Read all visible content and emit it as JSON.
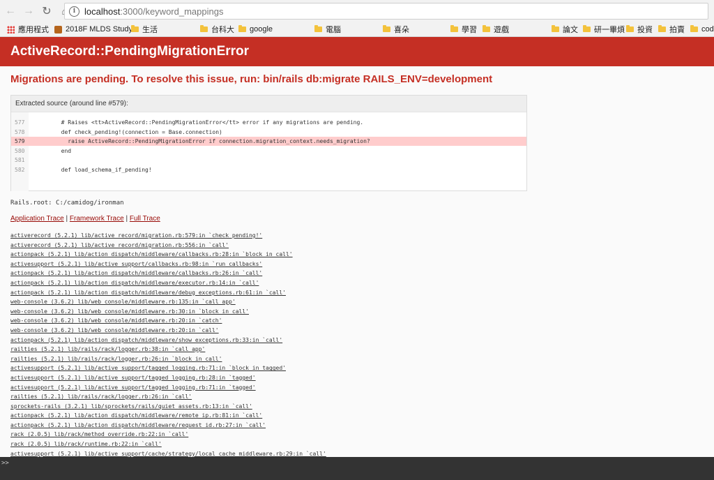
{
  "browser": {
    "url_host": "localhost",
    "url_path": ":3000/keyword_mappings",
    "bookmarks": [
      {
        "label": "應用程式",
        "icon": "apps-grid-icon"
      },
      {
        "label": "2018F MLDS Study",
        "icon": "site-favicon-icon"
      },
      {
        "label": "生活",
        "icon": "folder-icon"
      },
      {
        "label": "台科大",
        "icon": "folder-icon"
      },
      {
        "label": "google",
        "icon": "folder-icon"
      },
      {
        "label": "電腦",
        "icon": "folder-icon"
      },
      {
        "label": "喜朵",
        "icon": "folder-icon"
      },
      {
        "label": "學習",
        "icon": "folder-icon"
      },
      {
        "label": "遊戲",
        "icon": "folder-icon"
      },
      {
        "label": "論文",
        "icon": "folder-icon"
      },
      {
        "label": "研一畢煩",
        "icon": "folder-icon"
      },
      {
        "label": "投資",
        "icon": "folder-icon"
      },
      {
        "label": "拍賣",
        "icon": "folder-icon"
      },
      {
        "label": "code",
        "icon": "folder-icon"
      }
    ]
  },
  "error": {
    "header": "ActiveRecord::PendingMigrationError",
    "message": "Migrations are pending. To resolve this issue, run: bin/rails db:migrate RAILS_ENV=development",
    "source_title": "Extracted source (around line #579):",
    "lines": [
      {
        "num": "577",
        "code": "  # Raises <tt>ActiveRecord::PendingMigrationError</tt> error if any migrations are pending."
      },
      {
        "num": "578",
        "code": "  def check_pending!(connection = Base.connection)"
      },
      {
        "num": "579",
        "code": "    raise ActiveRecord::PendingMigrationError if connection.migration_context.needs_migration?"
      },
      {
        "num": "580",
        "code": "  end"
      },
      {
        "num": "581",
        "code": ""
      },
      {
        "num": "582",
        "code": "  def load_schema_if_pending!"
      }
    ],
    "highlight_line": "579",
    "rails_root": "Rails.root: C:/camidog/ironman"
  },
  "trace_tabs": [
    "Application Trace",
    "Framework Trace",
    "Full Trace"
  ],
  "trace": [
    "activerecord (5.2.1) lib/active_record/migration.rb:579:in `check_pending!'",
    "activerecord (5.2.1) lib/active_record/migration.rb:556:in `call'",
    "actionpack (5.2.1) lib/action_dispatch/middleware/callbacks.rb:28:in `block in call'",
    "activesupport (5.2.1) lib/active_support/callbacks.rb:98:in `run_callbacks'",
    "actionpack (5.2.1) lib/action_dispatch/middleware/callbacks.rb:26:in `call'",
    "actionpack (5.2.1) lib/action_dispatch/middleware/executor.rb:14:in `call'",
    "actionpack (5.2.1) lib/action_dispatch/middleware/debug_exceptions.rb:61:in `call'",
    "web-console (3.6.2) lib/web_console/middleware.rb:135:in `call_app'",
    "web-console (3.6.2) lib/web_console/middleware.rb:30:in `block in call'",
    "web-console (3.6.2) lib/web_console/middleware.rb:20:in `catch'",
    "web-console (3.6.2) lib/web_console/middleware.rb:20:in `call'",
    "actionpack (5.2.1) lib/action_dispatch/middleware/show_exceptions.rb:33:in `call'",
    "railties (5.2.1) lib/rails/rack/logger.rb:38:in `call_app'",
    "railties (5.2.1) lib/rails/rack/logger.rb:26:in `block in call'",
    "activesupport (5.2.1) lib/active_support/tagged_logging.rb:71:in `block in tagged'",
    "activesupport (5.2.1) lib/active_support/tagged_logging.rb:28:in `tagged'",
    "activesupport (5.2.1) lib/active_support/tagged_logging.rb:71:in `tagged'",
    "railties (5.2.1) lib/rails/rack/logger.rb:26:in `call'",
    "sprockets-rails (3.2.1) lib/sprockets/rails/quiet_assets.rb:13:in `call'",
    "actionpack (5.2.1) lib/action_dispatch/middleware/remote_ip.rb:81:in `call'",
    "actionpack (5.2.1) lib/action_dispatch/middleware/request_id.rb:27:in `call'",
    "rack (2.0.5) lib/rack/method_override.rb:22:in `call'",
    "rack (2.0.5) lib/rack/runtime.rb:22:in `call'",
    "activesupport (5.2.1) lib/active_support/cache/strategy/local_cache_middleware.rb:29:in `call'"
  ],
  "console": {
    "prompt": ">>"
  },
  "colors": {
    "header_red": "#c52f24",
    "highlight": "#ffcccc",
    "console_bg": "#333333"
  }
}
